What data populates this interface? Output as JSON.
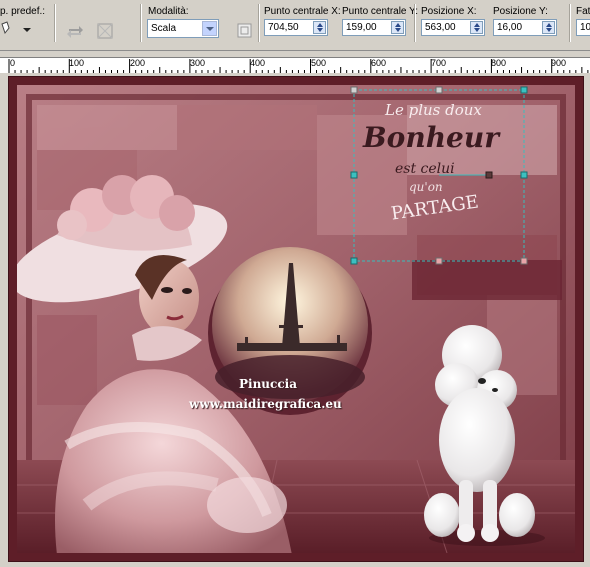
{
  "toolbar": {
    "preset_label": "p. predef.:",
    "modality_label": "Modalità:",
    "modality_value": "Scala",
    "center_x_label": "Punto centrale X:",
    "center_x_value": "704,50",
    "center_y_label": "Punto centrale Y:",
    "center_y_value": "159,00",
    "pos_x_label": "Posizione X:",
    "pos_x_value": "563,00",
    "pos_y_label": "Posizione Y:",
    "pos_y_value": "16,00",
    "cut_label": "Fat",
    "cut_value": "10"
  },
  "ruler": {
    "labels": [
      "0",
      "100",
      "200",
      "300",
      "400",
      "500",
      "600",
      "700",
      "800",
      "900"
    ]
  },
  "artwork": {
    "watermark_name": "Pinuccia",
    "watermark_url": "www.maidiregrafica.eu",
    "text_line1": "Le plus doux",
    "text_line2": "Bonheur",
    "text_line3": "est celui",
    "text_line4": "qu'on",
    "text_line5": "PARTAGE"
  },
  "colors": {
    "frame": "#5e1e28",
    "background_rose": "#a7646c",
    "selection_handles": "#3cc0c0"
  }
}
